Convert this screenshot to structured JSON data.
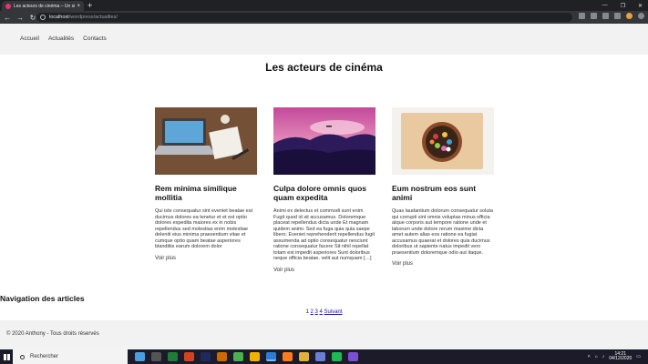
{
  "browser": {
    "tab_title": "Les acteurs de cinéma – Un site d",
    "tab_close": "×",
    "new_tab": "+",
    "window_controls": [
      "—",
      "❐",
      "✕"
    ],
    "url_host": "localhost",
    "url_path": "/wordpress/actualites/"
  },
  "site": {
    "nav": [
      "Accueil",
      "Actualités",
      "Contacts"
    ],
    "page_title": "Les acteurs de cinéma",
    "articles": [
      {
        "title": "Rem minima similique mollitia",
        "excerpt": "Qui iste consequatur sint eveniet beatae est ducimus dolores ea tenetur et et est optio dolores expedita maiores ex in nobis repellendus sed molestias enim molestiae deleniti eius minima praesentium vitae et cumque optio quam beatae asperiores blanditiis earum dolorem dolor",
        "more": "Voir plus",
        "image": "laptop-desk-photo"
      },
      {
        "title": "Culpa dolore omnis quos quam expedita",
        "excerpt": "Animi ex delectus et commodi sunt enim Fugit quod id sit accusamus. Doloremque placeat repellendus dicta unde Et magnam quidem animi. Sed ea fuga quia quia saepe libero. Eveniet reprehenderit repellendus fugit assumenda ad optio consequatur nesciunt ratione consequatur facere Sit nihil repellat totam est impedit asperiores Sunt doloribus neque officia beatae. velit aut numquam […]",
        "more": "Voir plus",
        "image": "purple-sky-clouds-photo"
      },
      {
        "title": "Eum nostrum eos sunt animi",
        "excerpt": "Quas laudantium dolorum consequatur soluta qui corrupti sint omnis voluptas minus officia atque corporis aut tempore ratione unde et laborum unde dolore rerum maxime dicta amet autem alias eos ratione ea fugiat accusamus quaerat et dolores quia ducimus doloribus ut sapiente natus impedit vero praesentium doloremque odio aut itaque.",
        "more": "Voir plus",
        "image": "candy-bowl-photo"
      }
    ],
    "pagination_heading": "Navigation des articles",
    "pagination": {
      "current": "1",
      "pages": [
        "2",
        "3",
        "4"
      ],
      "next": "Suivant"
    },
    "footer": "© 2020 Anthony - Tous droits réservés"
  },
  "taskbar": {
    "search_placeholder": "Rechercher",
    "time": "14:21",
    "date": "04/12/2020",
    "app_colors": [
      "#4a9ede",
      "#555555",
      "#1e7d3a",
      "#d04423",
      "#1f2a5c",
      "#cc6a00",
      "#4caf50",
      "#f0b400",
      "#2a7fd4",
      "#ff7a1a",
      "#e0b03a",
      "#6a7fd4",
      "#1db954",
      "#7a4fd4"
    ]
  }
}
